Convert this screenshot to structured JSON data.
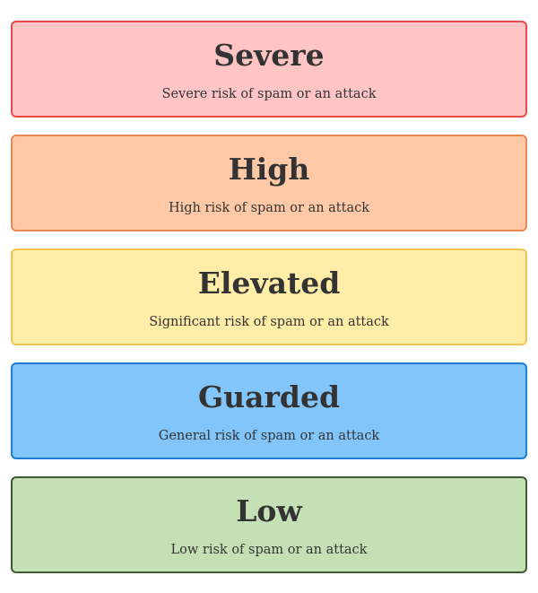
{
  "levels": [
    {
      "title": "Severe",
      "description": "Severe risk of spam or an attack",
      "background": "#ffc4c4",
      "border": "#e64a4a"
    },
    {
      "title": "High",
      "description": "High risk of spam or an attack",
      "background": "#ffc9a8",
      "border": "#ec8a54"
    },
    {
      "title": "Elevated",
      "description": "Significant risk of spam or an attack",
      "background": "#ffeda8",
      "border": "#eec352"
    },
    {
      "title": "Guarded",
      "description": "General risk of spam or an attack",
      "background": "#81c5fa",
      "border": "#1f7fd6"
    },
    {
      "title": "Low",
      "description": "Low risk of spam or an attack",
      "background": "#c6e0b6",
      "border": "#3e5a34"
    }
  ]
}
